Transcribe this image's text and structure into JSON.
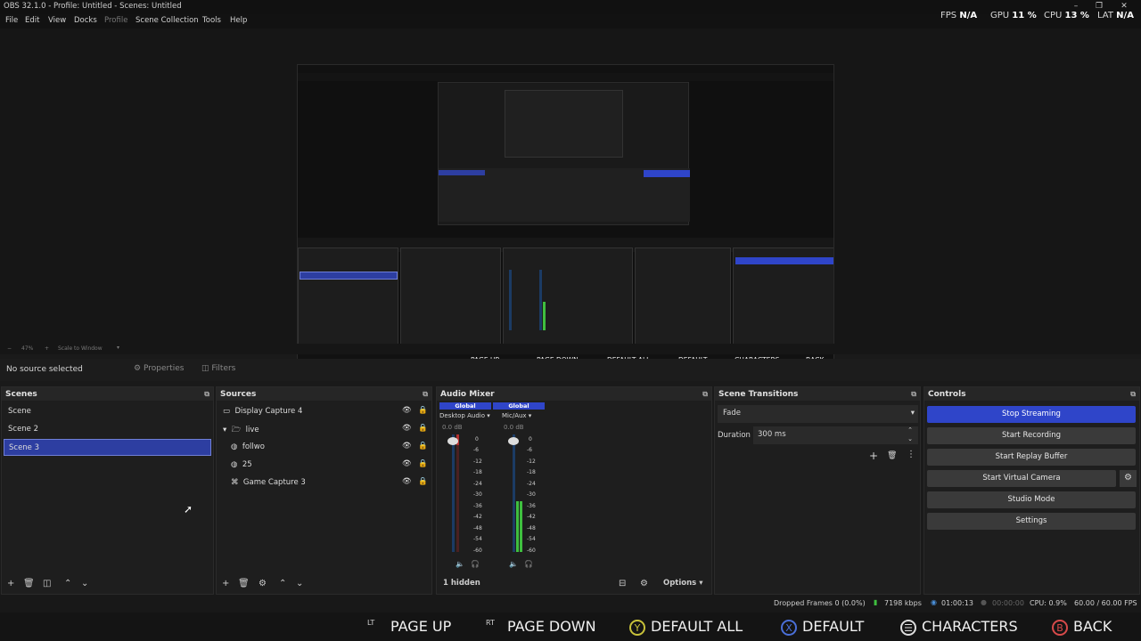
{
  "window": {
    "title": "OBS 32.1.0 - Profile: Untitled - Scenes: Untitled"
  },
  "menu": [
    "File",
    "Edit",
    "View",
    "Docks",
    "Profile",
    "Scene Collection",
    "Tools",
    "Help"
  ],
  "stats": {
    "fps_label": "FPS",
    "fps_value": "N/A",
    "gpu_label": "GPU",
    "gpu_value": "11 %",
    "cpu_label": "CPU",
    "cpu_value": "13 %",
    "lat_label": "LAT",
    "lat_value": "N/A"
  },
  "zoom": {
    "value": "47%",
    "mode": "Scale to Window"
  },
  "source_bar": {
    "no_source": "No source selected",
    "properties": "Properties",
    "filters": "Filters"
  },
  "scenes": {
    "title": "Scenes",
    "items": [
      "Scene",
      "Scene 2",
      "Scene 3"
    ],
    "selected": 2
  },
  "sources": {
    "title": "Sources",
    "items": [
      "Display Capture 4",
      "live",
      "follwo",
      "25",
      "Game Capture 3"
    ]
  },
  "audio": {
    "title": "Audio Mixer",
    "channels": [
      {
        "badge": "Global",
        "name": "Desktop Audio",
        "db": "0.0 dB"
      },
      {
        "badge": "Global",
        "name": "Mic/Aux",
        "db": "0.0 dB"
      }
    ],
    "scale": [
      "0",
      "-6",
      "-12",
      "-18",
      "-24",
      "-30",
      "-36",
      "-42",
      "-48",
      "-54",
      "-60"
    ],
    "hidden": "1 hidden",
    "options": "Options"
  },
  "transitions": {
    "title": "Scene Transitions",
    "selected": "Fade",
    "duration_label": "Duration",
    "duration_value": "300 ms"
  },
  "controls": {
    "title": "Controls",
    "buttons": [
      "Stop Streaming",
      "Start Recording",
      "Start Replay Buffer",
      "Start Virtual Camera",
      "Studio Mode",
      "Settings"
    ]
  },
  "status": {
    "dropped": "Dropped Frames 0 (0.0%)",
    "kbps": "7198 kbps",
    "stream_time": "01:00:13",
    "rec_time": "00:00:00",
    "cpu": "CPU: 0.9%",
    "fps": "60.00 / 60.00 FPS"
  },
  "hints": [
    {
      "badge": "LT",
      "label": "PAGE UP"
    },
    {
      "badge": "RT",
      "label": "PAGE DOWN"
    },
    {
      "badge": "Y",
      "label": "DEFAULT ALL",
      "color": "#c8c23a"
    },
    {
      "badge": "X",
      "label": "DEFAULT",
      "color": "#4a6fd8"
    },
    {
      "badge": "☰",
      "label": "CHARACTERS",
      "color": "#dddddd"
    },
    {
      "badge": "B",
      "label": "BACK",
      "color": "#d84a4a"
    }
  ],
  "colors": {
    "accent": "#2f45c9",
    "meter_green": "#3fbf3f",
    "meter_red": "#b23030"
  }
}
